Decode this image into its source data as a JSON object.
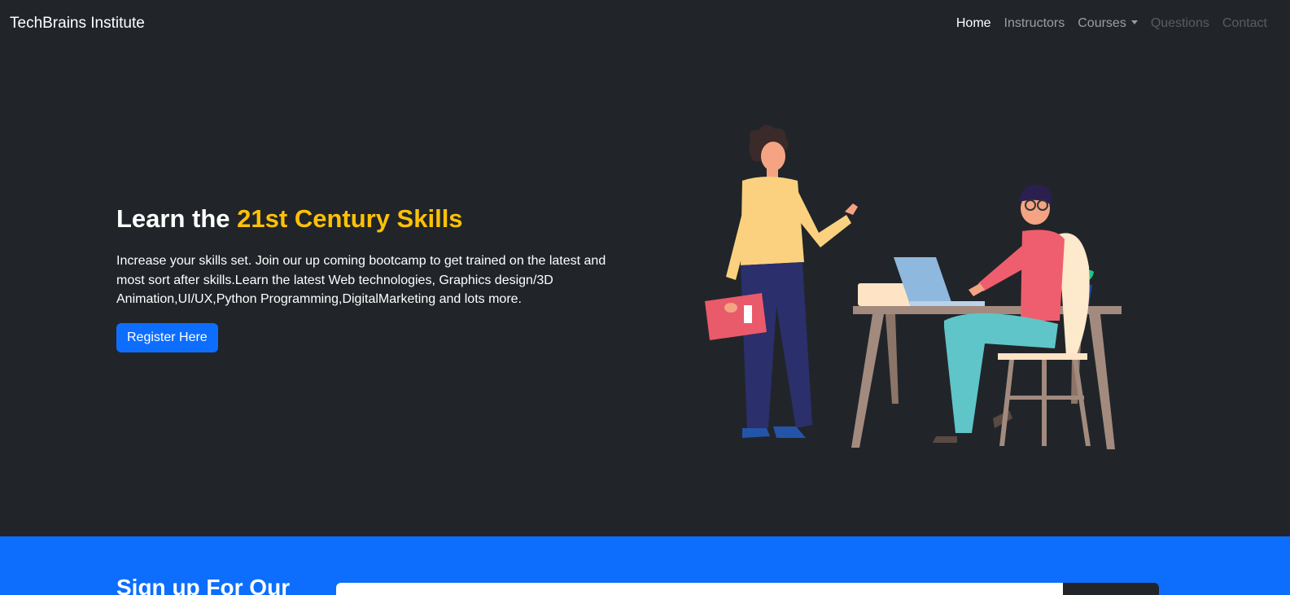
{
  "navbar": {
    "brand": "TechBrains Institute",
    "links": [
      {
        "label": "Home",
        "state": "active"
      },
      {
        "label": "Instructors",
        "state": "normal"
      },
      {
        "label": "Courses",
        "state": "dropdown"
      },
      {
        "label": "Questions",
        "state": "disabled"
      },
      {
        "label": "Contact",
        "state": "disabled"
      }
    ]
  },
  "hero": {
    "title_prefix": "Learn the ",
    "title_highlight": "21st Century Skills",
    "lead": "Increase your skills set. Join our up coming bootcamp to get trained on the latest and most sort after skills.Learn the latest Web technologies, Graphics design/3D Animation,UI/UX,Python Programming,DigitalMarketing and lots more.",
    "cta_label": "Register Here"
  },
  "signup": {
    "title": "Sign up For Our",
    "input_placeholder": "",
    "button_label": ""
  },
  "colors": {
    "background": "#212529",
    "accent": "#ffc107",
    "primary": "#0d6efd"
  }
}
